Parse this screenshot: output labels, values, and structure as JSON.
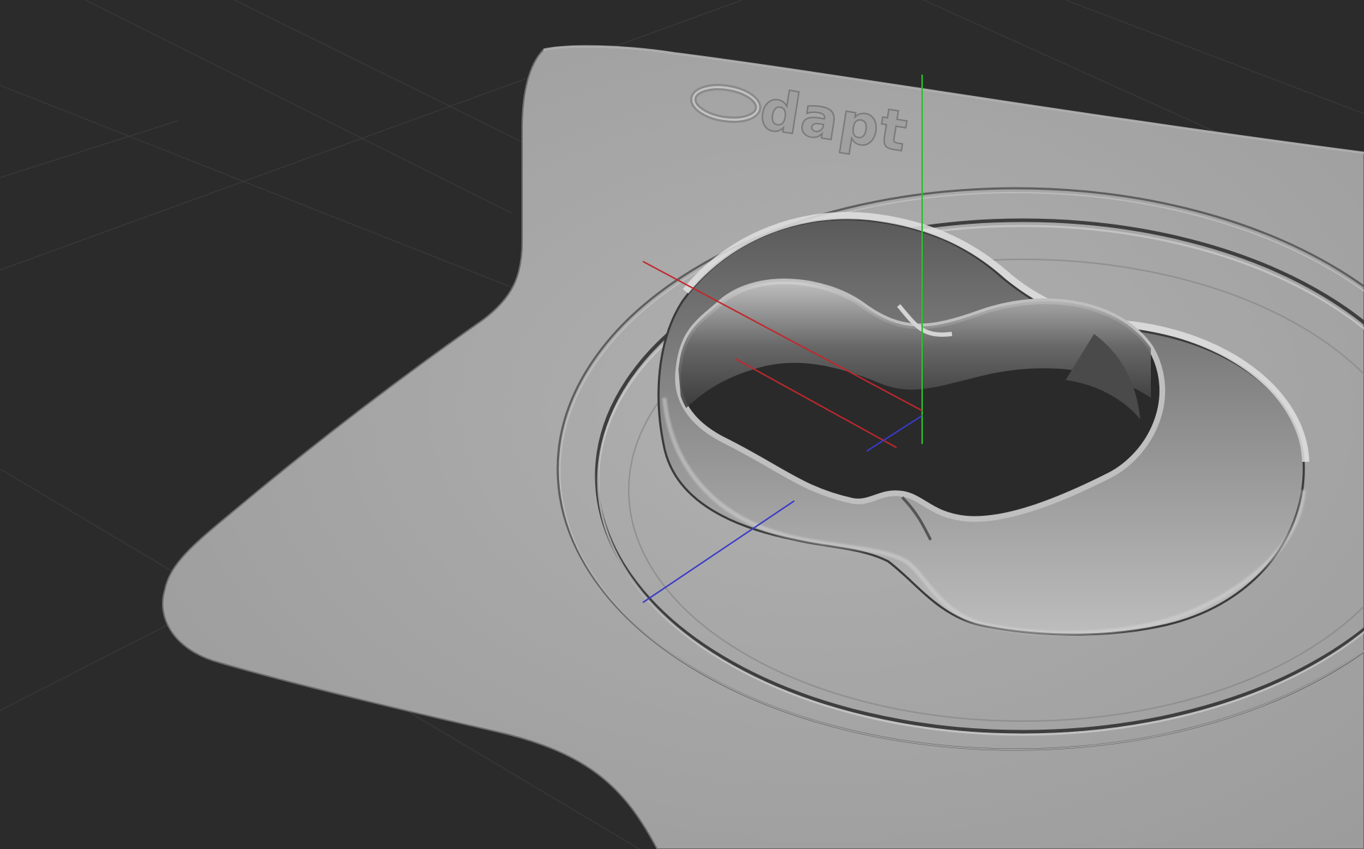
{
  "viewport": {
    "background": "#2b2b2b",
    "grid_color": "#3c3c3c"
  },
  "model": {
    "surface_color": "#a6a6a6",
    "embossed_logo": "dapt"
  },
  "gizmo": {
    "x_axis": {
      "name": "x-axis",
      "color": "#c0282d"
    },
    "y_axis": {
      "name": "y-axis",
      "color": "#2ac02a"
    },
    "z_axis": {
      "name": "z-axis",
      "color": "#3a3ac8"
    }
  }
}
